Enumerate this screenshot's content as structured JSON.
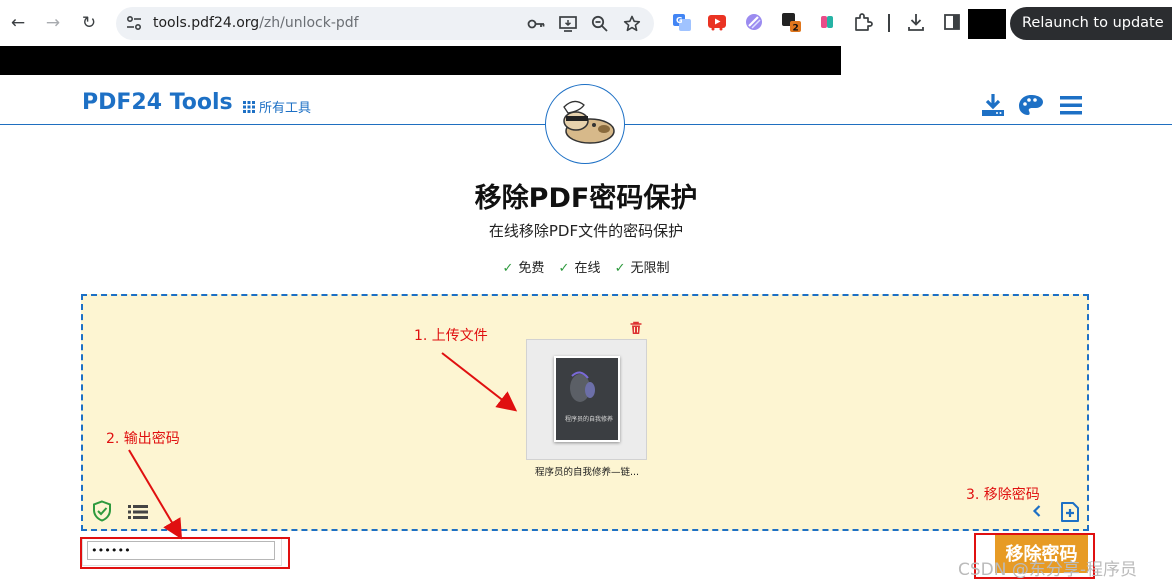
{
  "browser": {
    "url_host": "tools.pdf24.org",
    "url_path": "/zh/unlock-pdf",
    "relaunch_label": "Relaunch to update",
    "extension_badge": "2"
  },
  "site": {
    "logo": "PDF24 Tools",
    "all_tools": "所有工具"
  },
  "page": {
    "title": "移除PDF密码保护",
    "subtitle": "在线移除PDF文件的密码保护",
    "features": [
      "免费",
      "在线",
      "无限制"
    ]
  },
  "file": {
    "name": "程序员的自我修养—链...",
    "cover_title": "程序员的自我修养"
  },
  "password": {
    "value": "••••••"
  },
  "actions": {
    "remove_label": "移除密码"
  },
  "annotations": {
    "step1": "1. 上传文件",
    "step2": "2. 输出密码",
    "step3": "3. 移除密码"
  },
  "watermark": "CSDN @东分享-程序员",
  "colors": {
    "brand_blue": "#1d70c5",
    "dropzone_bg": "#fdf5d2",
    "button_orange": "#e79b25",
    "annotation_red": "#e01010"
  }
}
